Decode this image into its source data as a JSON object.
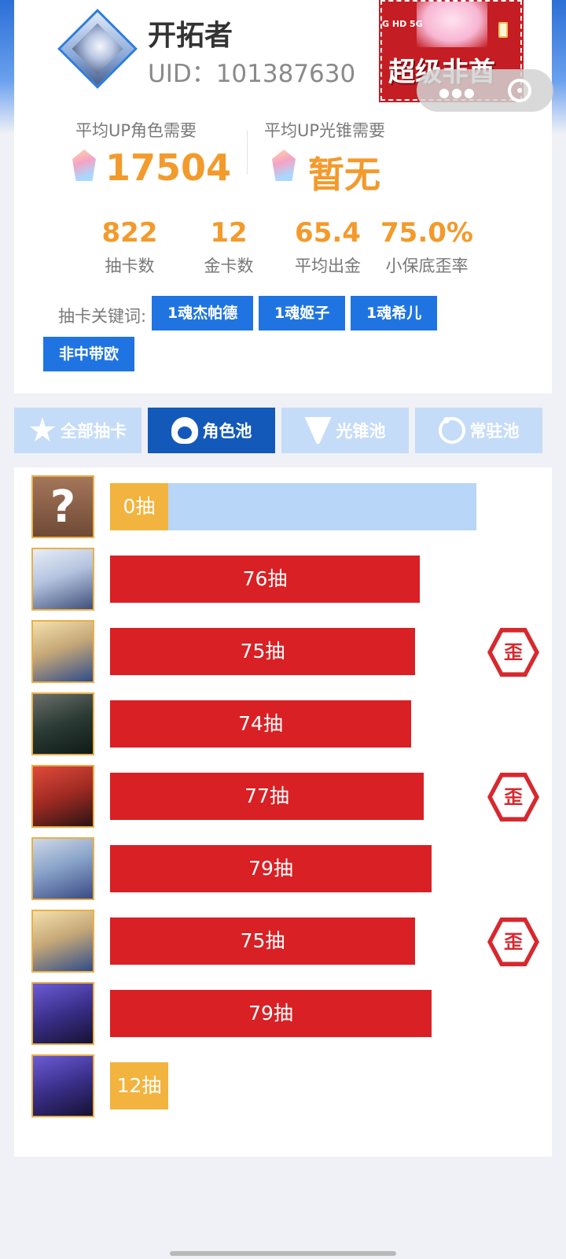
{
  "profile": {
    "name": "开拓者",
    "uid": "UID：101387630"
  },
  "banner": {
    "text": "超级非酋",
    "status_text": "G HD 5G"
  },
  "averages": {
    "char_label": "平均UP角色需要",
    "char_value": "17504",
    "cone_label": "平均UP光锥需要",
    "cone_value": "暂无"
  },
  "stats": [
    {
      "value": "822",
      "label": "抽卡数"
    },
    {
      "value": "12",
      "label": "金卡数"
    },
    {
      "value": "65.4",
      "label": "平均出金"
    },
    {
      "value": "75.0%",
      "label": "小保底歪率"
    }
  ],
  "keywords": {
    "label": "抽卡关键词:",
    "tags": [
      "1魂杰帕德",
      "1魂姬子",
      "1魂希儿",
      "非中带欧"
    ]
  },
  "tabs": [
    {
      "label": "全部抽卡",
      "icon": "star-icon",
      "active": false
    },
    {
      "label": "角色池",
      "icon": "character-icon",
      "active": true
    },
    {
      "label": "光锥池",
      "icon": "light-cone-icon",
      "active": false
    },
    {
      "label": "常驻池",
      "icon": "ring-icon",
      "active": false
    }
  ],
  "pity_scale_max": 90,
  "pulls": [
    {
      "label": "0抽",
      "count": 0,
      "portrait": "unknown",
      "lost_5050": false,
      "pending": true
    },
    {
      "label": "76抽",
      "count": 76,
      "portrait": "silver-hair",
      "lost_5050": false
    },
    {
      "label": "75抽",
      "count": 75,
      "portrait": "blonde",
      "lost_5050": true
    },
    {
      "label": "74抽",
      "count": 74,
      "portrait": "dark-hair",
      "lost_5050": false
    },
    {
      "label": "77抽",
      "count": 77,
      "portrait": "red-hair",
      "lost_5050": true
    },
    {
      "label": "79抽",
      "count": 79,
      "portrait": "silver-goggles",
      "lost_5050": false
    },
    {
      "label": "75抽",
      "count": 75,
      "portrait": "blonde",
      "lost_5050": true
    },
    {
      "label": "79抽",
      "count": 79,
      "portrait": "purple-hair",
      "lost_5050": false
    },
    {
      "label": "12抽",
      "count": 12,
      "portrait": "purple-hair",
      "lost_5050": false
    }
  ],
  "badge_text": "歪",
  "colors": {
    "accent_orange": "#f39a2c",
    "bar_red": "#d92024",
    "bar_gold": "#f2b43e",
    "tab_active": "#1359b9",
    "tag_blue": "#1f74e2"
  }
}
